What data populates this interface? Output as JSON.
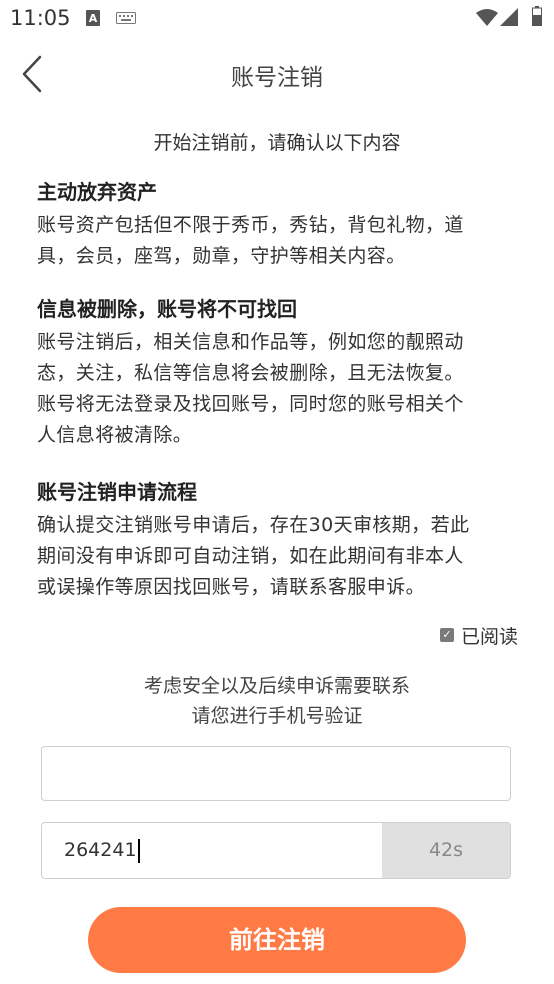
{
  "status_bar": {
    "time": "11:05"
  },
  "header": {
    "title": "账号注销"
  },
  "intro": "开始注销前，请确认以下内容",
  "sections": [
    {
      "title": "主动放弃资产",
      "lines": [
        "账号资产包括但不限于秀币，秀钻，背包礼物，道",
        "具，会员，座驾，勋章，守护等相关内容。"
      ]
    },
    {
      "title": "信息被删除，账号将不可找回",
      "lines": [
        "账号注销后，相关信息和作品等，例如您的靓照动",
        "态，关注，私信等信息将会被删除，且无法恢复。",
        "账号将无法登录及找回账号，同时您的账号相关个",
        "人信息将被清除。"
      ]
    },
    {
      "title": "账号注销申请流程",
      "lines": [
        "确认提交注销账号申请后，存在30天审核期，若此",
        "期间没有申诉即可自动注销，如在此期间有非本人",
        "或误操作等原因找回账号，请联系客服申诉。"
      ]
    }
  ],
  "read_checkbox": {
    "label": "已阅读",
    "checked": true
  },
  "verify_note": {
    "line1": "考虑安全以及后续申诉需要联系",
    "line2": "请您进行手机号验证"
  },
  "phone_input": {
    "value": "",
    "placeholder": ""
  },
  "code_input": {
    "value": "264241"
  },
  "countdown": "42s",
  "submit_button": {
    "label": "前往注销",
    "color": "#ff7a45"
  }
}
